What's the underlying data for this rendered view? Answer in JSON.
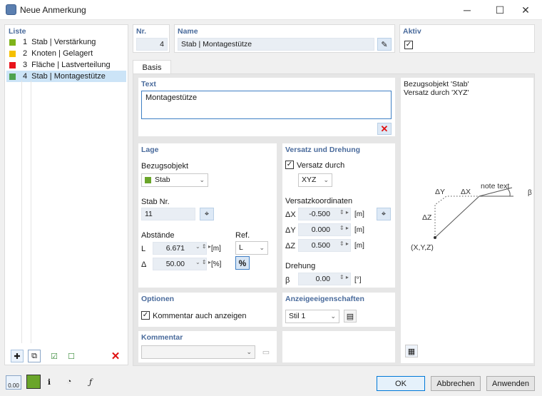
{
  "window": {
    "title": "Neue Anmerkung",
    "minimize": "─",
    "maximize": "☐",
    "close": "✕"
  },
  "list": {
    "header": "Liste",
    "items": [
      {
        "num": "1",
        "label": "Stab | Verstärkung",
        "color": "#7fb31a"
      },
      {
        "num": "2",
        "label": "Knoten | Gelagert",
        "color": "#f5c000"
      },
      {
        "num": "3",
        "label": "Fläche | Lastverteilung",
        "color": "#e8141c"
      },
      {
        "num": "4",
        "label": "Stab | Montagestütze",
        "color": "#4ea24e"
      }
    ]
  },
  "nr": {
    "header": "Nr.",
    "value": "4"
  },
  "name": {
    "header": "Name",
    "value": "Stab | Montagestütze"
  },
  "aktiv": {
    "header": "Aktiv",
    "checked": "✓"
  },
  "tab": {
    "label": "Basis"
  },
  "text": {
    "header": "Text",
    "value": "Montagestütze"
  },
  "lage": {
    "header": "Lage",
    "bezug_label": "Bezugsobjekt",
    "bezug_value": "Stab",
    "bezug_color": "#6aa52a",
    "stabnr_label": "Stab Nr.",
    "stabnr_value": "11",
    "abstaende_label": "Abstände",
    "ref_label": "Ref.",
    "L_label": "L",
    "L_value": "6.671",
    "L_unit": "[m]",
    "L_ref": "L",
    "D_label": "Δ",
    "D_value": "50.00",
    "D_unit": "[%]",
    "percent": "%"
  },
  "versatz": {
    "header": "Versatz und Drehung",
    "versatz_durch": "Versatz durch",
    "checked": "✓",
    "xyz": "XYZ",
    "koord_label": "Versatzkoordinaten",
    "dx_label": "ΔX",
    "dx": "-0.500",
    "dy_label": "ΔY",
    "dy": "0.000",
    "dz_label": "ΔZ",
    "dz": "0.500",
    "unit": "[m]",
    "drehung_label": "Drehung",
    "beta_label": "β",
    "beta": "0.00",
    "beta_unit": "[°]"
  },
  "preview": {
    "line1": "Bezugsobjekt 'Stab'",
    "line2": "Versatz durch 'XYZ'",
    "note_text": "note text",
    "dy": "ΔY",
    "dx": "ΔX",
    "dz": "ΔZ",
    "beta": "β",
    "origin": "(X,Y,Z)"
  },
  "optionen": {
    "header": "Optionen",
    "kommentar_anzeigen": "Kommentar auch anzeigen",
    "checked": "✓"
  },
  "anzeige": {
    "header": "Anzeigeeigenschaften",
    "stil": "Stil 1"
  },
  "kommentar": {
    "header": "Kommentar"
  },
  "buttons": {
    "ok": "OK",
    "cancel": "Abbrechen",
    "apply": "Anwenden"
  },
  "bottom_value": "0.00"
}
